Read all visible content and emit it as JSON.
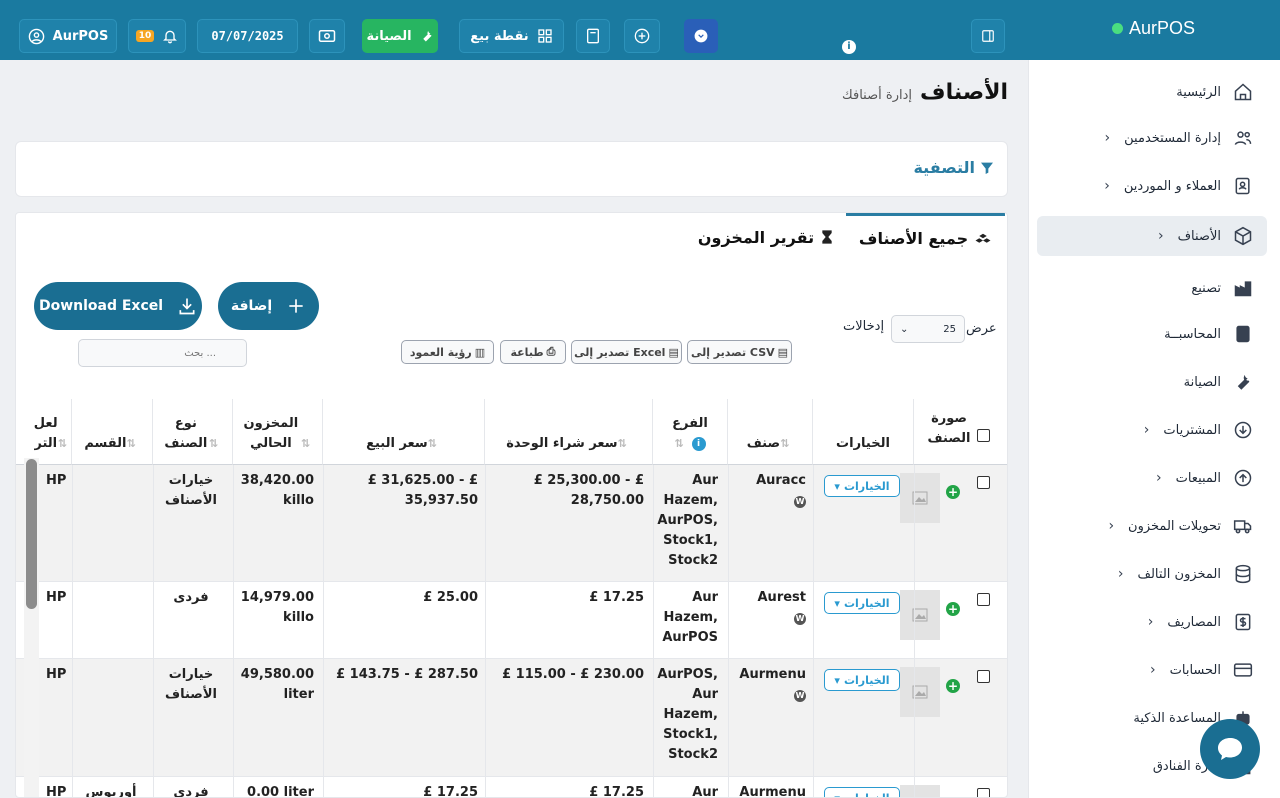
{
  "topbar": {
    "brand": "AurPOS",
    "user_label": "AurPOS",
    "notif_count": "10",
    "date": "07/07/2025",
    "maintenance_label": "الصيانة",
    "pos_label": "نقطة بيع"
  },
  "sidebar": {
    "items": [
      {
        "label": "الرئيسية",
        "icon": "home-icon",
        "chevron": false
      },
      {
        "label": "إدارة المستخدمين",
        "icon": "users-icon",
        "chevron": true
      },
      {
        "label": "العملاء و الموردين",
        "icon": "address-book-icon",
        "chevron": true
      },
      {
        "label": "الأصناف",
        "icon": "cube-icon",
        "chevron": true,
        "active": true
      },
      {
        "label": "تصنيع",
        "icon": "industry-icon",
        "chevron": false
      },
      {
        "label": "المحاسبــة",
        "icon": "book-icon",
        "chevron": false
      },
      {
        "label": "الصيانة",
        "icon": "wrench-icon",
        "chevron": false
      },
      {
        "label": "المشتريات",
        "icon": "download-circle-icon",
        "chevron": true
      },
      {
        "label": "المبيعات",
        "icon": "upload-circle-icon",
        "chevron": true
      },
      {
        "label": "تحويلات المخزون",
        "icon": "truck-icon",
        "chevron": true
      },
      {
        "label": "المخزون التالف",
        "icon": "database-icon",
        "chevron": true
      },
      {
        "label": "المصاريف",
        "icon": "dollar-icon",
        "chevron": true
      },
      {
        "label": "الحسابات",
        "icon": "credit-card-icon",
        "chevron": true
      },
      {
        "label": "المساعدة الذكية",
        "icon": "robot-icon",
        "chevron": false
      },
      {
        "label": "إدارة الفنادق",
        "icon": "hotel-icon",
        "chevron": false
      }
    ]
  },
  "page": {
    "title": "الأصناف",
    "subtitle": "إدارة أصنافك",
    "filter_label": "التصفية"
  },
  "tabs": {
    "all_items": "جميع الأصناف",
    "stock_report": "تقرير المخزون"
  },
  "toolbar": {
    "download_excel": "Download Excel",
    "add": "إضافة",
    "show_label": "عرض",
    "entries_label": "إدخالات",
    "page_length": "25",
    "export_csv": "تصدير إلى CSV",
    "export_excel": "تصدير إلى Excel",
    "print": "طباعة",
    "column_visibility": "رؤية العمود",
    "search_placeholder": "بحث ..."
  },
  "table": {
    "headers": {
      "image": "صورة الصنف",
      "options": "الخيارات",
      "item": "صنف",
      "branch": "الفرع",
      "unit_cost": "سعر شراء الوحدة",
      "sale_price": "سعر البيع",
      "stock": "المخزون الحالي",
      "type": "نوع الصنف",
      "category": "القسم",
      "brand": "العل التر"
    },
    "options_label": "الخيارات",
    "rows": [
      {
        "item": "Auracc",
        "branch": "Aur Hazem, AurPOS, Stock1, Stock2",
        "unit_cost": "£ 25,300.00 - £ 28,750.00",
        "sale_price": "£ 31,625.00 - £ 35,937.50",
        "stock": "38,420.00 killo",
        "type": "خيارات الأصناف",
        "category": "",
        "brand": "HP"
      },
      {
        "item": "Aurest",
        "branch": "Aur Hazem, AurPOS",
        "unit_cost": "£ 17.25",
        "sale_price": "£ 25.00",
        "stock": "14,979.00 killo",
        "type": "فردى",
        "category": "",
        "brand": "HP"
      },
      {
        "item": "Aurmenu",
        "branch": "AurPOS, Aur Hazem, Stock1, Stock2",
        "unit_cost": "£ 115.00 - £ 230.00",
        "sale_price": "£ 143.75 - £ 287.50",
        "stock": "49,580.00 liter",
        "type": "خيارات الأصناف",
        "category": "",
        "brand": "HP"
      },
      {
        "item": "Aurmenu",
        "branch": "Aur",
        "unit_cost": "£ 17.25",
        "sale_price": "£ 17.25",
        "stock": "0.00 liter",
        "type": "فردى",
        "category": "أوربوس",
        "brand": "HP"
      }
    ]
  }
}
